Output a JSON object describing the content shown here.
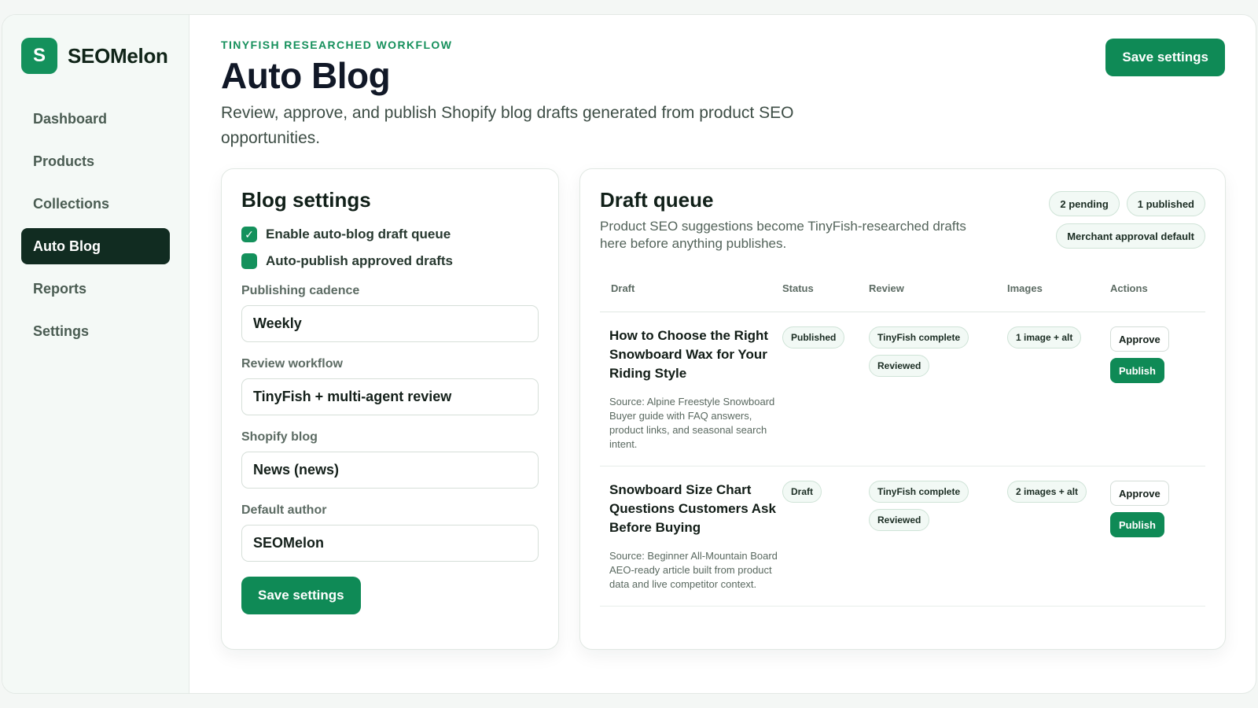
{
  "brand": {
    "initial": "S",
    "name": "SEOMelon"
  },
  "nav": [
    {
      "label": "Dashboard",
      "active": false
    },
    {
      "label": "Products",
      "active": false
    },
    {
      "label": "Collections",
      "active": false
    },
    {
      "label": "Auto Blog",
      "active": true
    },
    {
      "label": "Reports",
      "active": false
    },
    {
      "label": "Settings",
      "active": false
    }
  ],
  "header": {
    "eyebrow": "TINYFISH RESEARCHED WORKFLOW",
    "title": "Auto Blog",
    "subtitle": "Review, approve, and publish Shopify blog drafts generated from product SEO opportunities.",
    "save_label": "Save settings"
  },
  "settings": {
    "title": "Blog settings",
    "toggles": [
      {
        "label": "Enable auto-blog draft queue",
        "checked": true
      },
      {
        "label": "Auto-publish approved drafts",
        "checked": false
      }
    ],
    "fields": [
      {
        "label": "Publishing cadence",
        "value": "Weekly"
      },
      {
        "label": "Review workflow",
        "value": "TinyFish + multi-agent review"
      },
      {
        "label": "Shopify blog",
        "value": "News (news)"
      },
      {
        "label": "Default author",
        "value": "SEOMelon"
      }
    ],
    "save_label": "Save settings"
  },
  "queue": {
    "title": "Draft queue",
    "description": "Product SEO suggestions become TinyFish-researched drafts here before anything publishes.",
    "badges": [
      "2 pending",
      "1 published",
      "Merchant approval default"
    ],
    "columns": [
      "Draft",
      "Status",
      "Review",
      "Images",
      "Actions"
    ],
    "rows": [
      {
        "title": "How to Choose the Right Snowboard Wax for Your Riding Style",
        "source": "Source: Alpine Freestyle Snowboard",
        "summary": "Buyer guide with FAQ answers, product links, and seasonal search intent.",
        "status": "Published",
        "review": [
          "TinyFish complete",
          "Reviewed"
        ],
        "images": "1 image + alt",
        "approve_label": "Approve",
        "publish_label": "Publish"
      },
      {
        "title": "Snowboard Size Chart Questions Customers Ask Before Buying",
        "source": "Source: Beginner All-Mountain Board",
        "summary": "AEO-ready article built from product data and live competitor context.",
        "status": "Draft",
        "review": [
          "TinyFish complete",
          "Reviewed"
        ],
        "images": "2 images + alt",
        "approve_label": "Approve",
        "publish_label": "Publish"
      }
    ]
  }
}
